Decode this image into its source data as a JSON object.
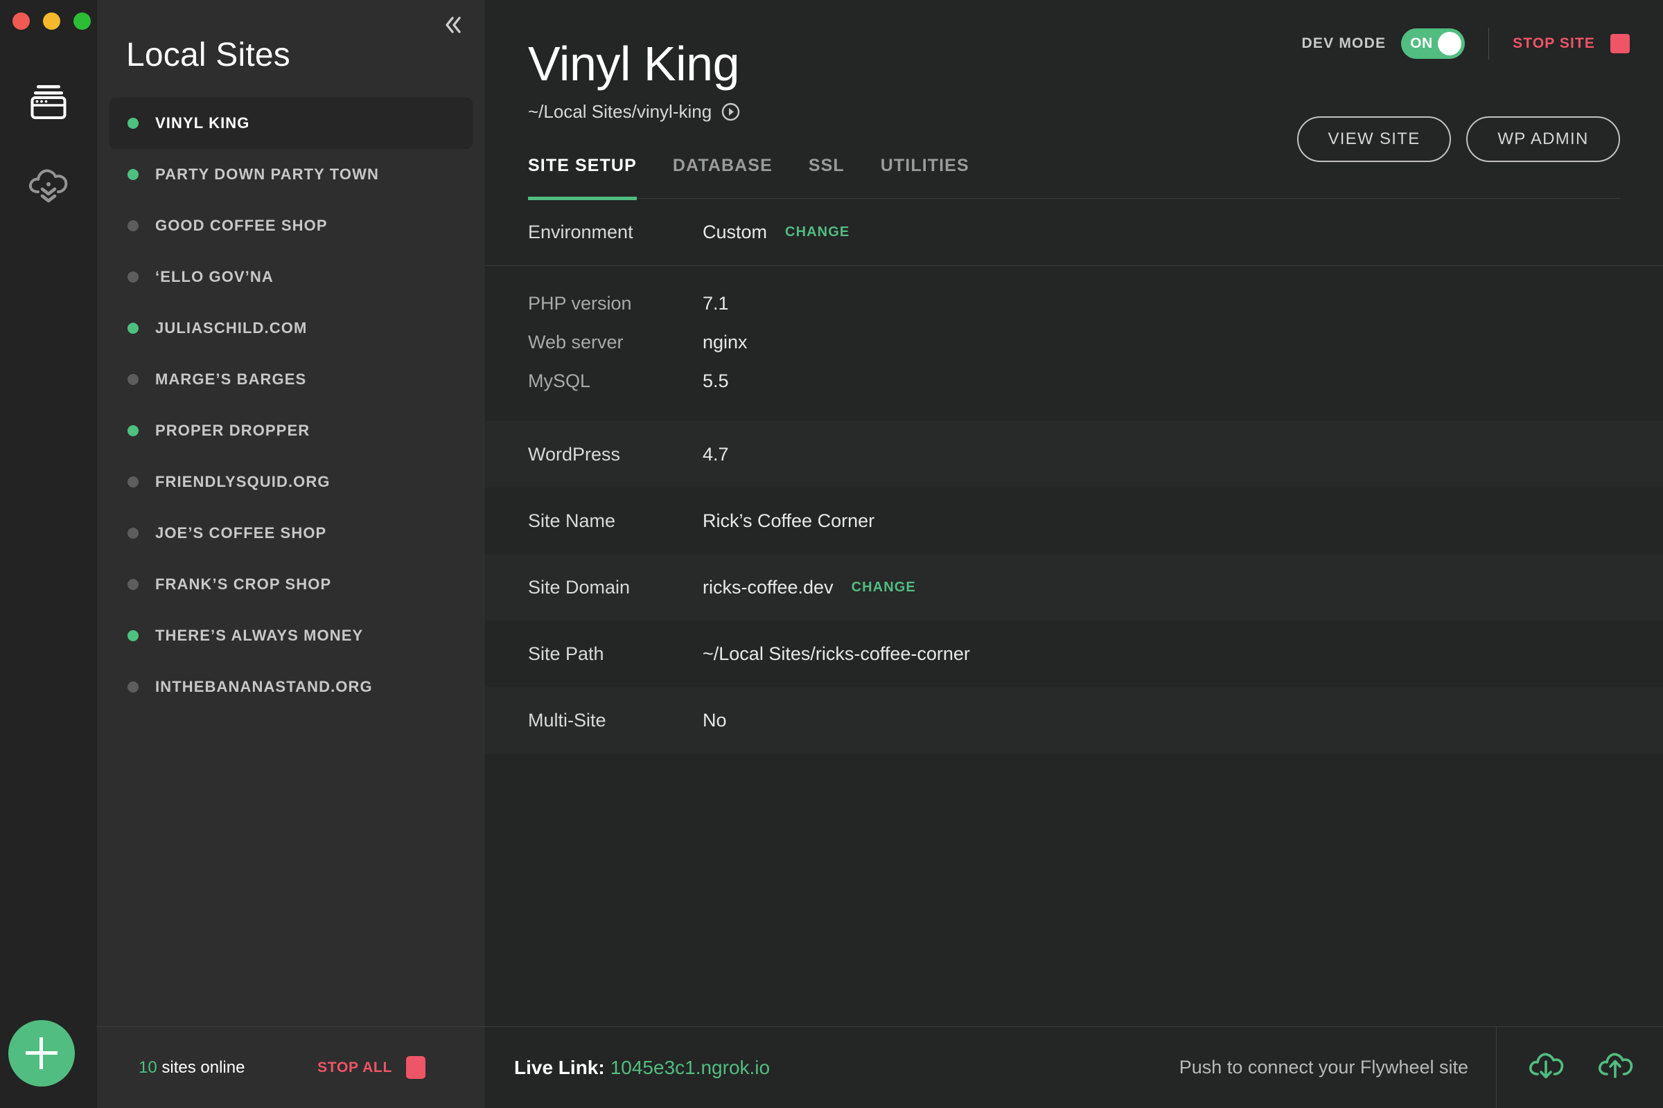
{
  "window": {
    "traffic_lights": [
      "close",
      "minimize",
      "maximize"
    ],
    "colors": {
      "accent_green": "#51bd80",
      "danger_red": "#ee5566",
      "sidebar_bg": "#2e2e2e",
      "main_bg": "#242525",
      "row_alt_bg": "#282929"
    }
  },
  "rail": {
    "items": [
      {
        "icon": "sites-stack-icon",
        "active": true
      },
      {
        "icon": "cloud-download-icon",
        "active": false
      }
    ]
  },
  "sidebar": {
    "title": "Local Sites",
    "collapse_icon": "chevron-double-left-icon",
    "items": [
      {
        "label": "VINYL KING",
        "status": "on",
        "active": true
      },
      {
        "label": "PARTY DOWN PARTY TOWN",
        "status": "on",
        "active": false
      },
      {
        "label": "GOOD COFFEE SHOP",
        "status": "off",
        "active": false
      },
      {
        "label": "‘ELLO GOV’NA",
        "status": "off",
        "active": false
      },
      {
        "label": "JULIASCHILD.COM",
        "status": "on",
        "active": false
      },
      {
        "label": "MARGE’S BARGES",
        "status": "off",
        "active": false
      },
      {
        "label": "PROPER DROPPER",
        "status": "on",
        "active": false
      },
      {
        "label": "FRIENDLYSQUID.ORG",
        "status": "off",
        "active": false
      },
      {
        "label": "JOE’S COFFEE SHOP",
        "status": "off",
        "active": false
      },
      {
        "label": "FRANK’S CROP SHOP",
        "status": "off",
        "active": false
      },
      {
        "label": "THERE’S ALWAYS MONEY",
        "status": "on",
        "active": false
      },
      {
        "label": "INTHEBANANASTAND.ORG",
        "status": "off",
        "active": false
      }
    ],
    "footer": {
      "count": "10",
      "online_text": " sites online",
      "stop_all_label": "STOP ALL",
      "add_site_icon": "plus-icon"
    }
  },
  "header": {
    "dev_mode_label": "DEV MODE",
    "dev_mode_state": "ON",
    "stop_site_label": "STOP SITE",
    "title": "Vinyl King",
    "path": "~/Local Sites/vinyl-king",
    "path_reveal_icon": "reveal-in-finder-icon"
  },
  "tabs": [
    {
      "label": "SITE SETUP",
      "active": true
    },
    {
      "label": "DATABASE",
      "active": false
    },
    {
      "label": "SSL",
      "active": false
    },
    {
      "label": "UTILITIES",
      "active": false
    }
  ],
  "actions": {
    "view_site": "VIEW SITE",
    "wp_admin": "WP ADMIN"
  },
  "details": {
    "environment": {
      "label": "Environment",
      "value": "Custom",
      "change": "CHANGE"
    },
    "php_version": {
      "label": "PHP version",
      "value": "7.1"
    },
    "web_server": {
      "label": "Web server",
      "value": "nginx"
    },
    "mysql": {
      "label": "MySQL",
      "value": "5.5"
    },
    "wordpress": {
      "label": "WordPress",
      "value": "4.7"
    },
    "site_name": {
      "label": "Site Name",
      "value": "Rick’s Coffee Corner"
    },
    "site_domain": {
      "label": "Site Domain",
      "value": "ricks-coffee.dev",
      "change": "CHANGE"
    },
    "site_path": {
      "label": "Site Path",
      "value": "~/Local Sites/ricks-coffee-corner"
    },
    "multi_site": {
      "label": "Multi-Site",
      "value": "No"
    }
  },
  "bottombar": {
    "live_link_label": "Live Link:",
    "live_link_url": "1045e3c1.ngrok.io",
    "flywheel_message": "Push to connect your Flywheel site",
    "pull_icon": "cloud-download-icon",
    "push_icon": "cloud-upload-icon"
  }
}
